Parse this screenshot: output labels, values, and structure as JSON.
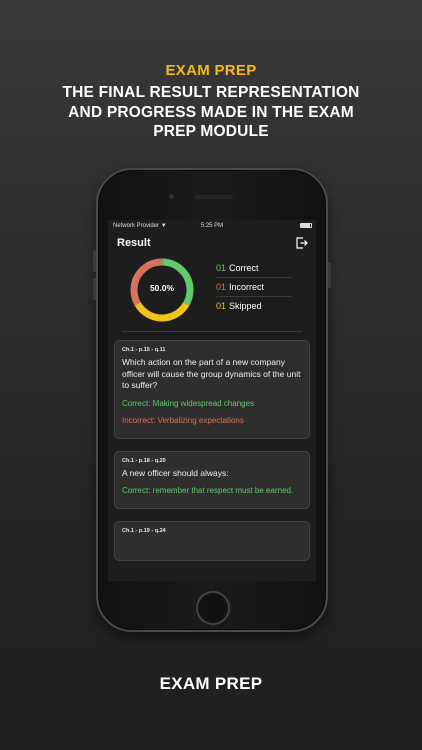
{
  "header": {
    "brand": "EXAM PREP",
    "tagline_lines": [
      "THE FINAL RESULT REPRESENTATION",
      "AND PROGRESS MADE IN THE EXAM",
      "PREP MODULE"
    ]
  },
  "statusbar": {
    "carrier": "Network Provider",
    "time": "5:25 PM"
  },
  "screen": {
    "title": "Result",
    "exit_icon": "exit-icon",
    "summary": {
      "percent_label": "50.0%",
      "ring_fractions": {
        "correct": 0.3333,
        "skipped": 0.3333,
        "incorrect": 0.3333
      },
      "colors": {
        "correct": "#63c96b",
        "incorrect": "#d6735a",
        "skipped": "#f0c419"
      },
      "legend": [
        {
          "count": "01",
          "label": "Correct",
          "color": "#63c96b"
        },
        {
          "count": "01",
          "label": "Incorrect",
          "color": "#d6735a"
        },
        {
          "count": "01",
          "label": "Skipped",
          "color": "#f0c419"
        }
      ]
    },
    "cards": [
      {
        "ref": "Ch.1 - p.15 - q.11",
        "question": "Which action on the part of a new company officer will cause the group dynamics of the unit to suffer?",
        "correct": "Correct: Making widespread changes",
        "incorrect": "Incorrect:  Verbalizing expectations"
      },
      {
        "ref": "Ch.1 - p.18 - q.20",
        "question": "A new officer should always:",
        "correct": "Correct: remember that respect must be earned.",
        "incorrect": ""
      },
      {
        "ref": "Ch.1 - p.19 - q.24",
        "question": "",
        "correct": "",
        "incorrect": ""
      }
    ]
  },
  "footer": "EXAM PREP"
}
